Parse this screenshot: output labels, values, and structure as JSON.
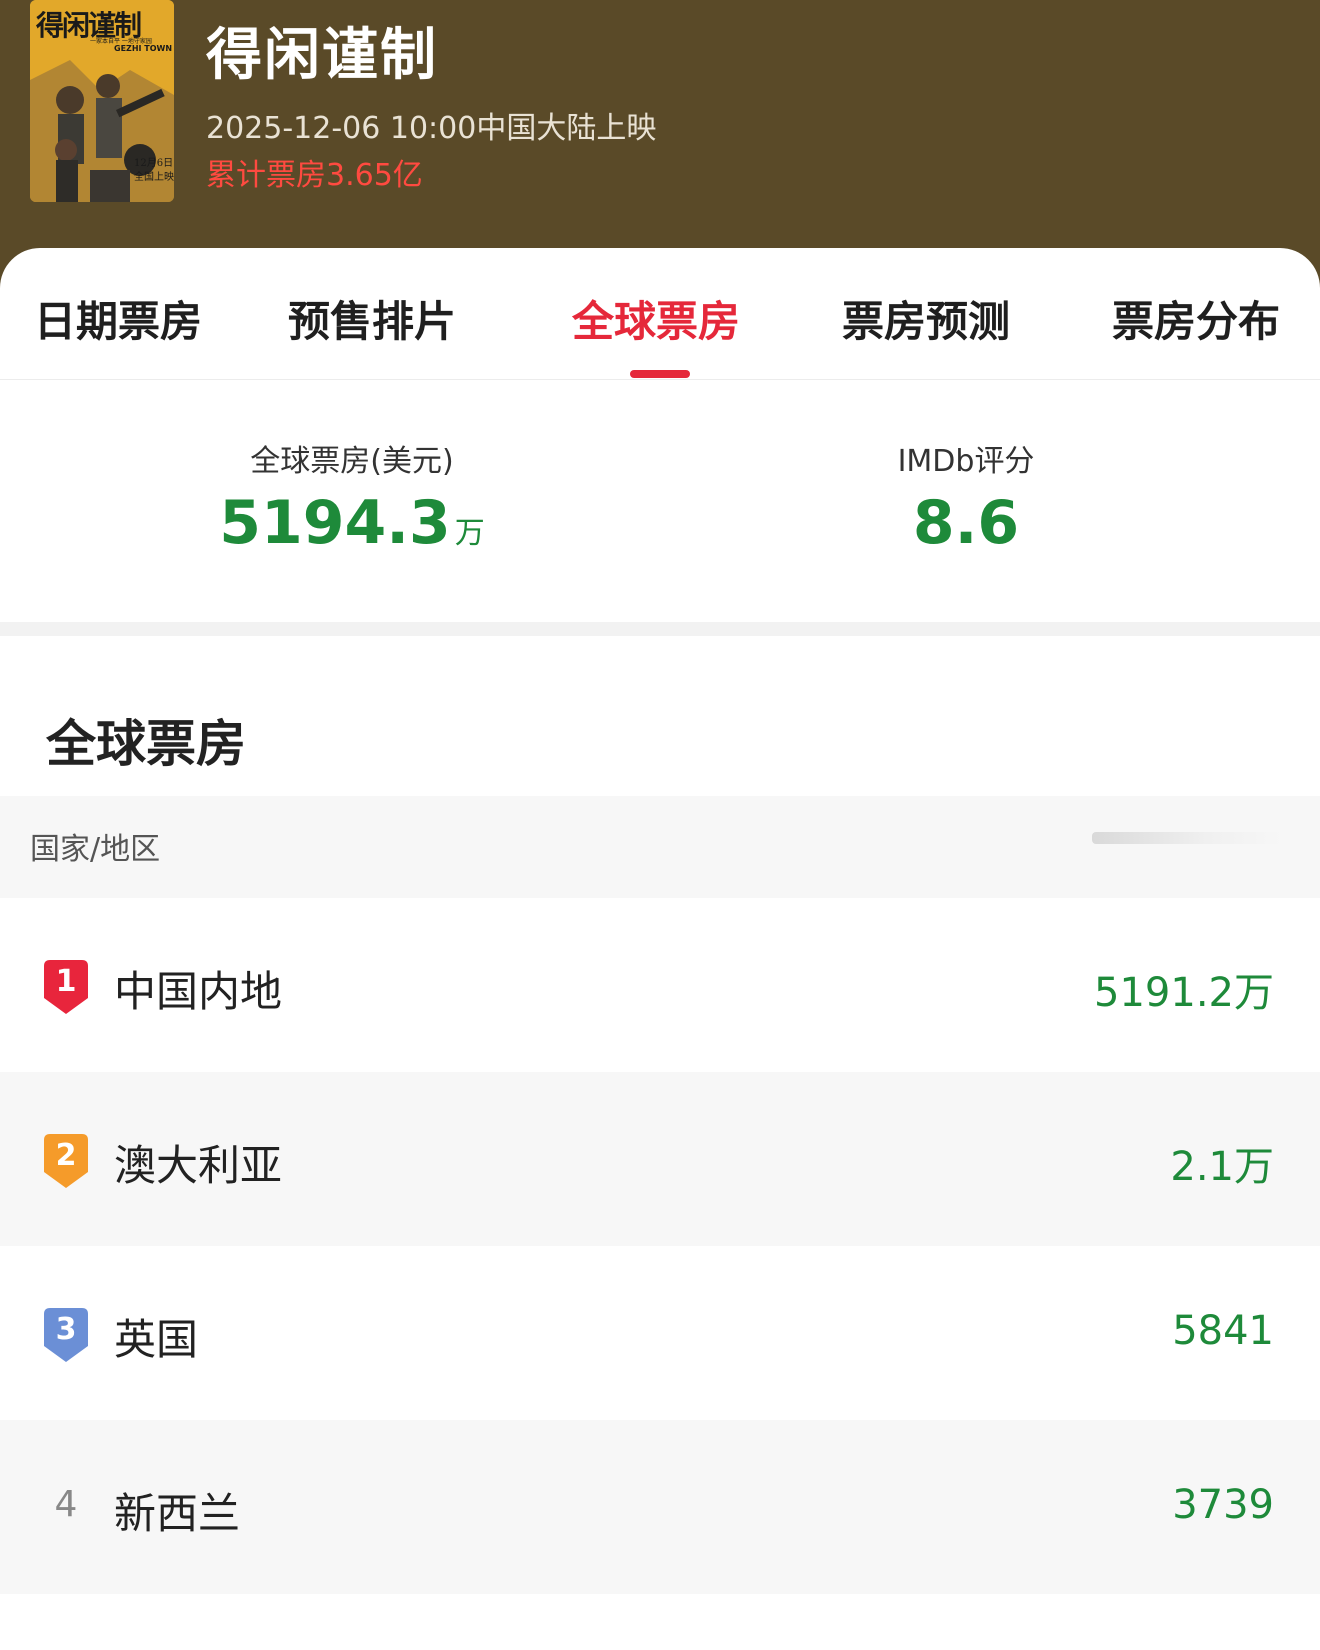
{
  "header": {
    "title": "得闲谨制",
    "release": "2025-12-06 10:00中国大陆上映",
    "cumulative_box_office": "累计票房3.65亿",
    "poster": {
      "title_text": "得闲谨制",
      "subtitle_text": "GEZHI TOWN",
      "tagline": "一家本自平 一地守家园",
      "date_text": "12月6日",
      "release_text": "全国上映"
    }
  },
  "tabs": [
    {
      "label": "日期票房",
      "active": false
    },
    {
      "label": "预售排片",
      "active": false
    },
    {
      "label": "全球票房",
      "active": true
    },
    {
      "label": "票房预测",
      "active": false
    },
    {
      "label": "票房分布",
      "active": false
    }
  ],
  "stats": {
    "global_label": "全球票房(美元)",
    "global_value": "5194.3",
    "global_unit": "万",
    "imdb_label": "IMDb评分",
    "imdb_value": "8.6"
  },
  "section": {
    "title": "全球票房",
    "column_label": "国家/地区"
  },
  "colors": {
    "header_bg": "#5a4a28",
    "accent_red": "#e5283a",
    "value_green": "#1e8a3a",
    "rank1": "#e8253c",
    "rank2": "#f59b2a",
    "rank3": "#6b8fd6"
  },
  "rows": [
    {
      "rank": "1",
      "country": "中国内地",
      "value": "5191.2万"
    },
    {
      "rank": "2",
      "country": "澳大利亚",
      "value": "2.1万"
    },
    {
      "rank": "3",
      "country": "英国",
      "value": "5841"
    },
    {
      "rank": "4",
      "country": "新西兰",
      "value": "3739"
    }
  ]
}
